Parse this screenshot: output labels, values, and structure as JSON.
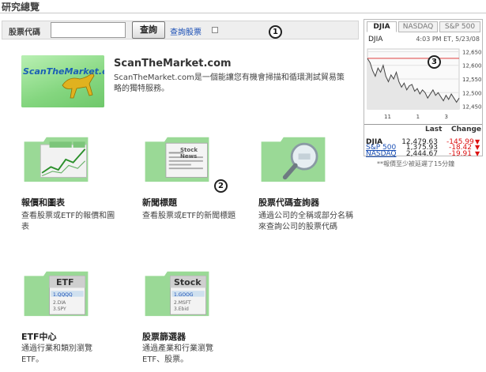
{
  "page": {
    "title": "研究總覽"
  },
  "search": {
    "label": "股票代碼",
    "value": "",
    "placeholder": "",
    "button_label": "查詢",
    "link_label": "查詢股票"
  },
  "callouts": [
    "1",
    "2",
    "3"
  ],
  "scanthemarket": {
    "logo_text": "ScanTheMarket.com",
    "title": "ScanTheMarket.com",
    "description": "ScanTheMarket.com是一個能讓您有機會掃描和循環測試貿易策略的獨特服務。"
  },
  "tiles": [
    {
      "title": "報價和圖表",
      "description": "查看股票或ETF的報價和圖表"
    },
    {
      "title": "新聞標題",
      "description": "查看股票或ETF的新聞標題",
      "art_label": "Stock News"
    },
    {
      "title": "股票代碼查詢器",
      "description": "通過公司的全稱或部分名稱來查詢公司的股票代碼"
    },
    {
      "title": "ETF中心",
      "description": "通過行業和類別瀏覽ETF。",
      "art_label": "ETF",
      "art_lines": [
        "1.QQQQ",
        "2.DIA",
        "3.SPY"
      ]
    },
    {
      "title": "股票篩選器",
      "description": "通過產業和行業瀏覽ETF、股票。",
      "art_label": "Stock",
      "art_lines": [
        "1.GOOG",
        "2.MSFT",
        "3.Ebid"
      ]
    }
  ],
  "widget": {
    "tabs": [
      "DJIA",
      "NASDAQ",
      "S&P 500"
    ],
    "active_tab": "DJIA",
    "ticker": "DJIA",
    "time": "4:03 PM ET, 5/23/08",
    "headers": {
      "last": "Last",
      "change": "Change"
    },
    "rows": [
      {
        "name": "DJIA",
        "last": "12,479.63",
        "change": "-145.99",
        "link": false
      },
      {
        "name": "NASDAQ",
        "last": "2,444.67",
        "change": "-19.91",
        "link": true
      },
      {
        "name": "S&P 500",
        "last": "1,375.93",
        "change": "-18.42",
        "link": true
      }
    ],
    "note": "**報價至少被延遲了15分鐘",
    "down_color": "#dd1111"
  },
  "chart_data": {
    "type": "line",
    "title": "",
    "xlabel": "",
    "ylabel": "",
    "x_ticks": [
      "11",
      "1",
      "3"
    ],
    "y_ticks": [
      12450,
      12500,
      12550,
      12600,
      12650
    ],
    "ylim": [
      12440,
      12660
    ],
    "previous_close": 12625.62,
    "series": [
      {
        "values": [
          12625,
          12610,
          12580,
          12560,
          12590,
          12575,
          12600,
          12560,
          12540,
          12565,
          12550,
          12575,
          12540,
          12520,
          12535,
          12510,
          12525,
          12530,
          12505,
          12515,
          12495,
          12510,
          12500,
          12480,
          12495,
          12510,
          12490,
          12500,
          12485,
          12470,
          12490,
          12475,
          12495,
          12480,
          12465,
          12480
        ]
      }
    ],
    "grid": true
  }
}
